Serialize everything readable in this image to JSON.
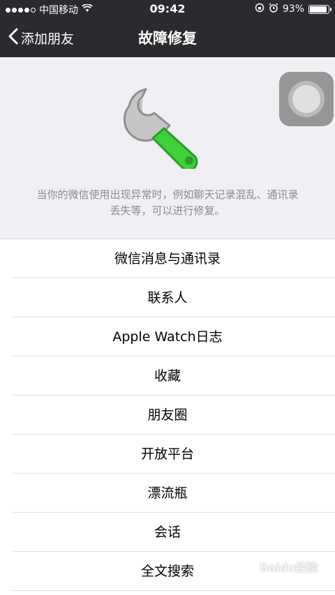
{
  "status_bar": {
    "carrier": "中国移动",
    "time": "09:42",
    "battery_percent": "93%",
    "battery_level": 0.93
  },
  "nav": {
    "back_label": "添加朋友",
    "title": "故障修复"
  },
  "header": {
    "description": "当你的微信使用出现异常时，例如聊天记录混乱、通讯录丢失等，可以进行修复。"
  },
  "list": {
    "items": [
      "微信消息与通讯录",
      "联系人",
      "Apple Watch日志",
      "收藏",
      "朋友圈",
      "开放平台",
      "漂流瓶",
      "会话",
      "全文搜索"
    ]
  },
  "colors": {
    "nav_bg": "#2b2b2f",
    "accent_green": "#3fcf3a",
    "page_bg": "#efeff4"
  },
  "watermark": {
    "text": "Baidu经验"
  }
}
